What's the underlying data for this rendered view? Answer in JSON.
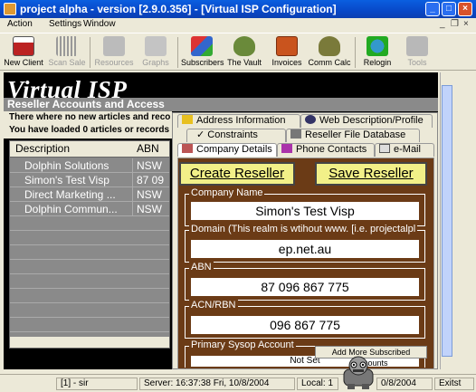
{
  "window": {
    "title": "project alpha - version [2.9.0.356] - [Virtual ISP Configuration]",
    "min": "_",
    "max": "□",
    "close": "×"
  },
  "menu": {
    "items": [
      "Action",
      "Settings",
      "Window"
    ],
    "mdi": [
      "_",
      "❐",
      "×"
    ]
  },
  "toolbar": {
    "buttons": [
      {
        "label": "New Client",
        "icon": "new-client-icon",
        "enabled": true
      },
      {
        "label": "Scan Sale",
        "icon": "barcode-icon",
        "enabled": false
      },
      {
        "label": "Resources",
        "icon": "resources-icon",
        "enabled": false
      },
      {
        "label": "Graphs",
        "icon": "graphs-icon",
        "enabled": false
      },
      {
        "label": "Subscribers",
        "icon": "subscribers-icon",
        "enabled": true
      },
      {
        "label": "The Vault",
        "icon": "money-bag-icon",
        "enabled": true
      },
      {
        "label": "Invoices",
        "icon": "invoices-icon",
        "enabled": true
      },
      {
        "label": "Comm Calc",
        "icon": "comm-calc-icon",
        "enabled": true
      },
      {
        "label": "Relogin",
        "icon": "relogin-icon",
        "enabled": true
      },
      {
        "label": "Tools",
        "icon": "tools-icon",
        "enabled": false
      }
    ]
  },
  "main": {
    "heading": "Virtual ISP",
    "subheading": "Reseller Accounts and Access",
    "info1": "There where no new articles and reco",
    "info2": "You have loaded 0 articles or records",
    "grid": {
      "columns": [
        "Description",
        "ABN"
      ],
      "rows": [
        [
          "Dolphin Solutions",
          "NSW"
        ],
        [
          "Simon's Test Visp",
          "87 09"
        ],
        [
          "Direct Marketing ...",
          "NSW"
        ],
        [
          "Dolphin Commun...",
          "NSW"
        ]
      ]
    }
  },
  "tabs": {
    "row1": [
      "Address Information",
      "Web Description/Profile"
    ],
    "row2": [
      "Constraints",
      "Reseller File Database"
    ],
    "row3": [
      "Company Details",
      "Phone Contacts",
      "e-Mail"
    ]
  },
  "form": {
    "create_label": "Create Reseller",
    "save_label": "Save Reseller",
    "company_name_label": "Company Name",
    "company_name": "Simon's Test Visp",
    "domain_label": "Domain (This realm is wtihout www. [i.e. projectalpl",
    "domain": "ep.net.au",
    "abn_label": "ABN",
    "abn": "87  096  867  775",
    "acn_label": "ACN/RBN",
    "acn": "096  867  775",
    "sysop_label": "Primary Sysop Account",
    "sysop_value": "Not Set",
    "add_more_label": "Add More Subscribed Accounts"
  },
  "status": {
    "user": "[1] - sir",
    "server": "Server: 16:37:38 Fri, 10/8/2004",
    "local": "Local: 1",
    "local_date": "0/8/2004",
    "mode": "Exitst"
  },
  "colors": {
    "panel": "#6b3b16",
    "button": "#f2f088",
    "grid": "#8a8a8a"
  }
}
